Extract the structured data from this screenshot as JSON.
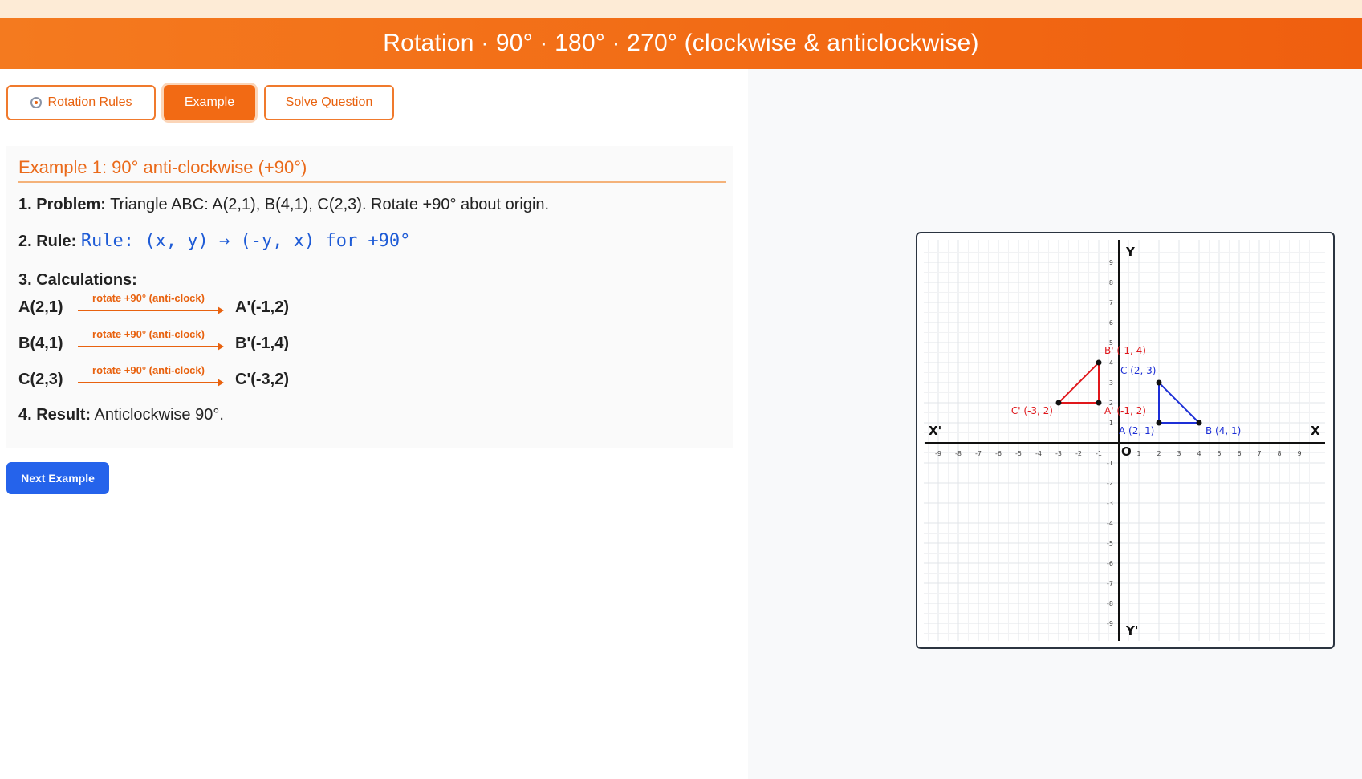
{
  "header": {
    "title": "Rotation · 90° · 180° · 270° (clockwise & anticlockwise)"
  },
  "tabs": [
    {
      "label": "Rotation Rules",
      "icon": "compass-icon",
      "active": false
    },
    {
      "label": "Example",
      "active": true
    },
    {
      "label": "Solve Question",
      "active": false
    }
  ],
  "example": {
    "title": "Example 1: 90° anti-clockwise (+90°)",
    "problem_label": "1. Problem:",
    "problem_text": "Triangle ABC: A(2,1), B(4,1), C(2,3). Rotate +90° about origin.",
    "rule_label": "2. Rule:",
    "rule_text": "Rule: (x, y) → (-y, x) for +90°",
    "calc_label": "3. Calculations:",
    "calculations": [
      {
        "from": "A(2,1)",
        "op": "rotate +90° (anti-clock)",
        "to": "A'(-1,2)"
      },
      {
        "from": "B(4,1)",
        "op": "rotate +90° (anti-clock)",
        "to": "B'(-1,4)"
      },
      {
        "from": "C(2,3)",
        "op": "rotate +90° (anti-clock)",
        "to": "C'(-3,2)"
      }
    ],
    "result_label": "4. Result:",
    "result_text": "Anticlockwise 90°."
  },
  "next_button": "Next Example",
  "graph": {
    "axis_labels": {
      "x_pos": "X",
      "x_neg": "X'",
      "y_pos": "Y",
      "y_neg": "Y'",
      "origin": "O"
    },
    "range": [
      -9,
      9
    ],
    "original": {
      "color": "#1d2fd6",
      "points": [
        {
          "label": "A (2, 1)",
          "x": 2,
          "y": 1
        },
        {
          "label": "B (4, 1)",
          "x": 4,
          "y": 1
        },
        {
          "label": "C (2, 3)",
          "x": 2,
          "y": 3
        }
      ]
    },
    "image": {
      "color": "#e0181c",
      "points": [
        {
          "label": "A' (-1, 2)",
          "x": -1,
          "y": 2
        },
        {
          "label": "B' (-1, 4)",
          "x": -1,
          "y": 4
        },
        {
          "label": "C' (-3, 2)",
          "x": -3,
          "y": 2
        }
      ]
    }
  }
}
